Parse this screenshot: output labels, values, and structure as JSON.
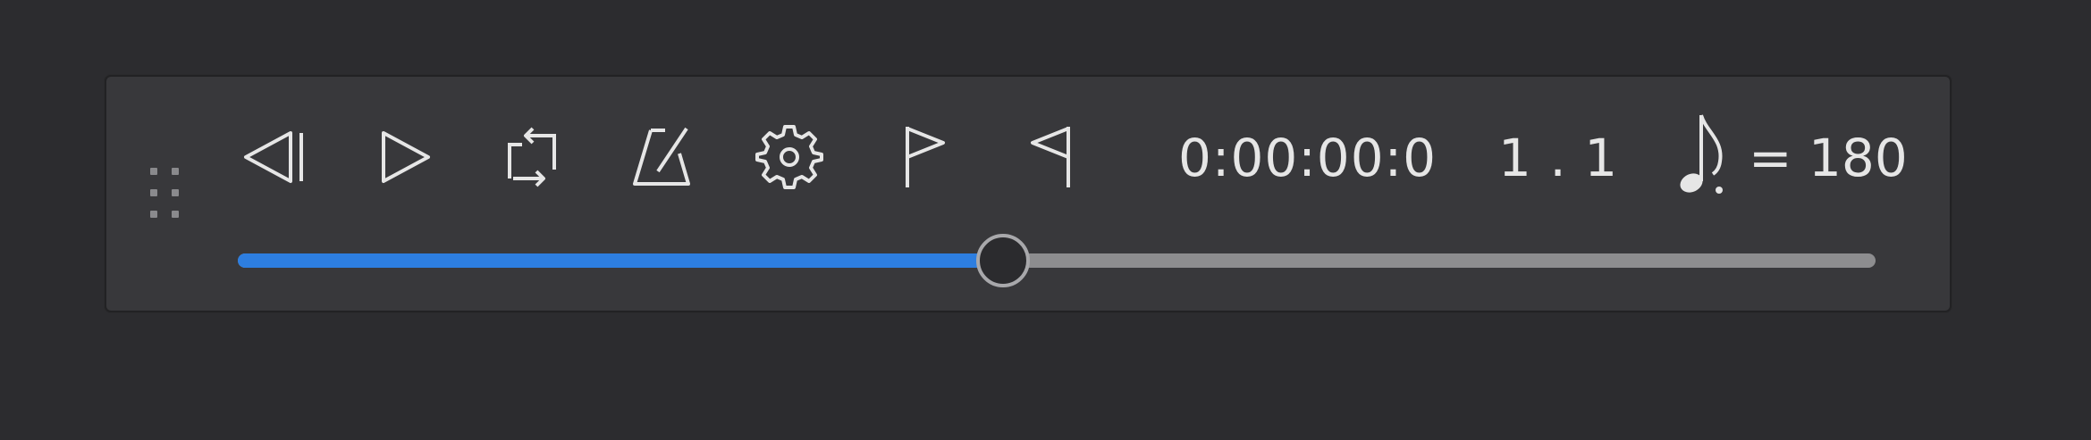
{
  "toolbar": {
    "icons": {
      "grip": "drag-handle-icon",
      "rewind": "rewind-to-start-icon",
      "play": "play-icon",
      "loop": "loop-icon",
      "metronome": "metronome-icon",
      "settings": "gear-icon",
      "loop_start": "loop-start-flag-icon",
      "loop_end": "loop-end-flag-icon",
      "note": "dotted-eighth-note-icon"
    },
    "time": "0:00:00:0",
    "measure": "1 . 1",
    "tempo_equals": "= 180",
    "tempo_value": 180
  },
  "progress": {
    "fraction": 0.467
  },
  "colors": {
    "background": "#2c2c2f",
    "panel": "#38383b",
    "icon": "#e6e6e6",
    "progress_fill": "#2d7ee0",
    "progress_track": "#8d8d8f"
  }
}
